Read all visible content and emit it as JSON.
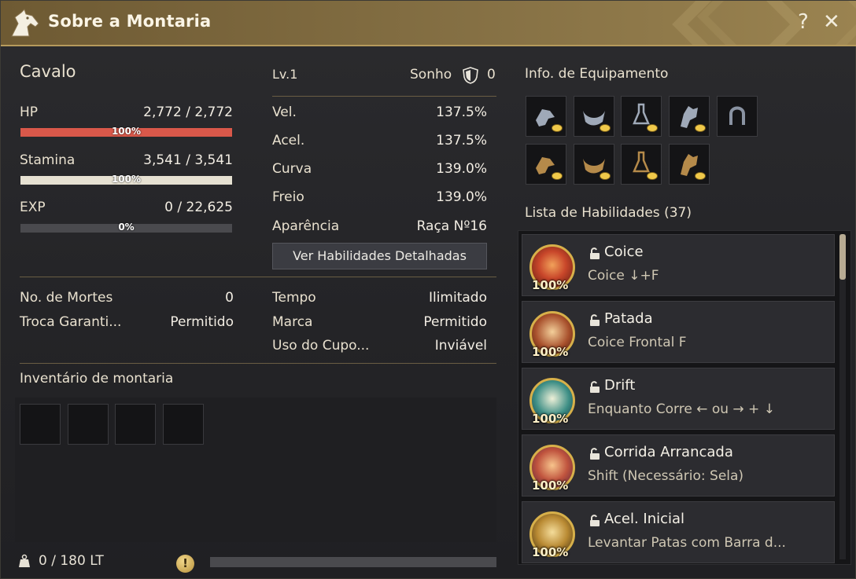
{
  "window": {
    "title": "Sobre a Montaria",
    "help_label": "?",
    "close_label": "✕"
  },
  "mount": {
    "name": "Cavalo",
    "hp_label": "HP",
    "hp_value": "2,772 / 2,772",
    "hp_percent_text": "100%",
    "hp_fill": 1.0,
    "stamina_label": "Stamina",
    "stamina_value": "3,541 / 3,541",
    "stamina_percent_text": "100%",
    "stamina_fill": 1.0,
    "exp_label": "EXP",
    "exp_value": "0 / 22,625",
    "exp_percent_text": "0%",
    "exp_fill": 0.0
  },
  "stats": {
    "level": "Lv.1",
    "dream_label": "Sonho",
    "dream_value": "0",
    "rows": [
      {
        "label": "Vel.",
        "value": "137.5%"
      },
      {
        "label": "Acel.",
        "value": "137.5%"
      },
      {
        "label": "Curva",
        "value": "139.0%"
      },
      {
        "label": "Freio",
        "value": "139.0%"
      },
      {
        "label": "Aparência",
        "value": "Raça Nº16"
      }
    ],
    "detail_button": "Ver Habilidades Detalhadas"
  },
  "info": {
    "deaths_label": "No. de Mortes",
    "deaths_value": "0",
    "trade_label": "Troca Garanti...",
    "trade_value": "Permitido",
    "time_label": "Tempo",
    "time_value": "Ilimitado",
    "brand_label": "Marca",
    "brand_value": "Permitido",
    "coupon_label": "Uso do Cupo...",
    "coupon_value": "Inviável"
  },
  "inventory": {
    "title": "Inventário de montaria",
    "weight": "0 / 180 LT",
    "warning_symbol": "!",
    "slot_count": 4
  },
  "equipment": {
    "title": "Info. de Equipamento",
    "row1": [
      "champron-icon",
      "saddle-icon",
      "stirrups-icon",
      "barding-icon",
      "horseshoe-icon"
    ],
    "row2": [
      "champron-icon",
      "saddle-icon",
      "stirrups-icon",
      "barding-icon"
    ]
  },
  "skills": {
    "title": "Lista de Habilidades (37)",
    "items": [
      {
        "name": "Coice",
        "command": "Coice ↓+F",
        "percent": "100%",
        "icon": "kick-skill-icon",
        "color": "#c8462a"
      },
      {
        "name": "Patada",
        "command": "Coice Frontal F",
        "percent": "100%",
        "icon": "front-kick-skill-icon",
        "color": "#a8502c"
      },
      {
        "name": "Drift",
        "command": "Enquanto Corre ← ou → + ↓",
        "percent": "100%",
        "icon": "drift-skill-icon",
        "color": "#3e8f86"
      },
      {
        "name": "Corrida Arrancada",
        "command": "Shift (Necessário: Sela)",
        "percent": "100%",
        "icon": "sprint-skill-icon",
        "color": "#c0543e"
      },
      {
        "name": "Acel. Inicial",
        "command": "Levantar Patas com Barra d...",
        "percent": "100%",
        "icon": "acceleration-skill-icon",
        "color": "#b98a33"
      }
    ]
  },
  "colors": {
    "hp": "#d9584a",
    "stamina": "#e6e1d2",
    "exp": "#4b4b50",
    "accent_gold": "#d7b04a"
  }
}
